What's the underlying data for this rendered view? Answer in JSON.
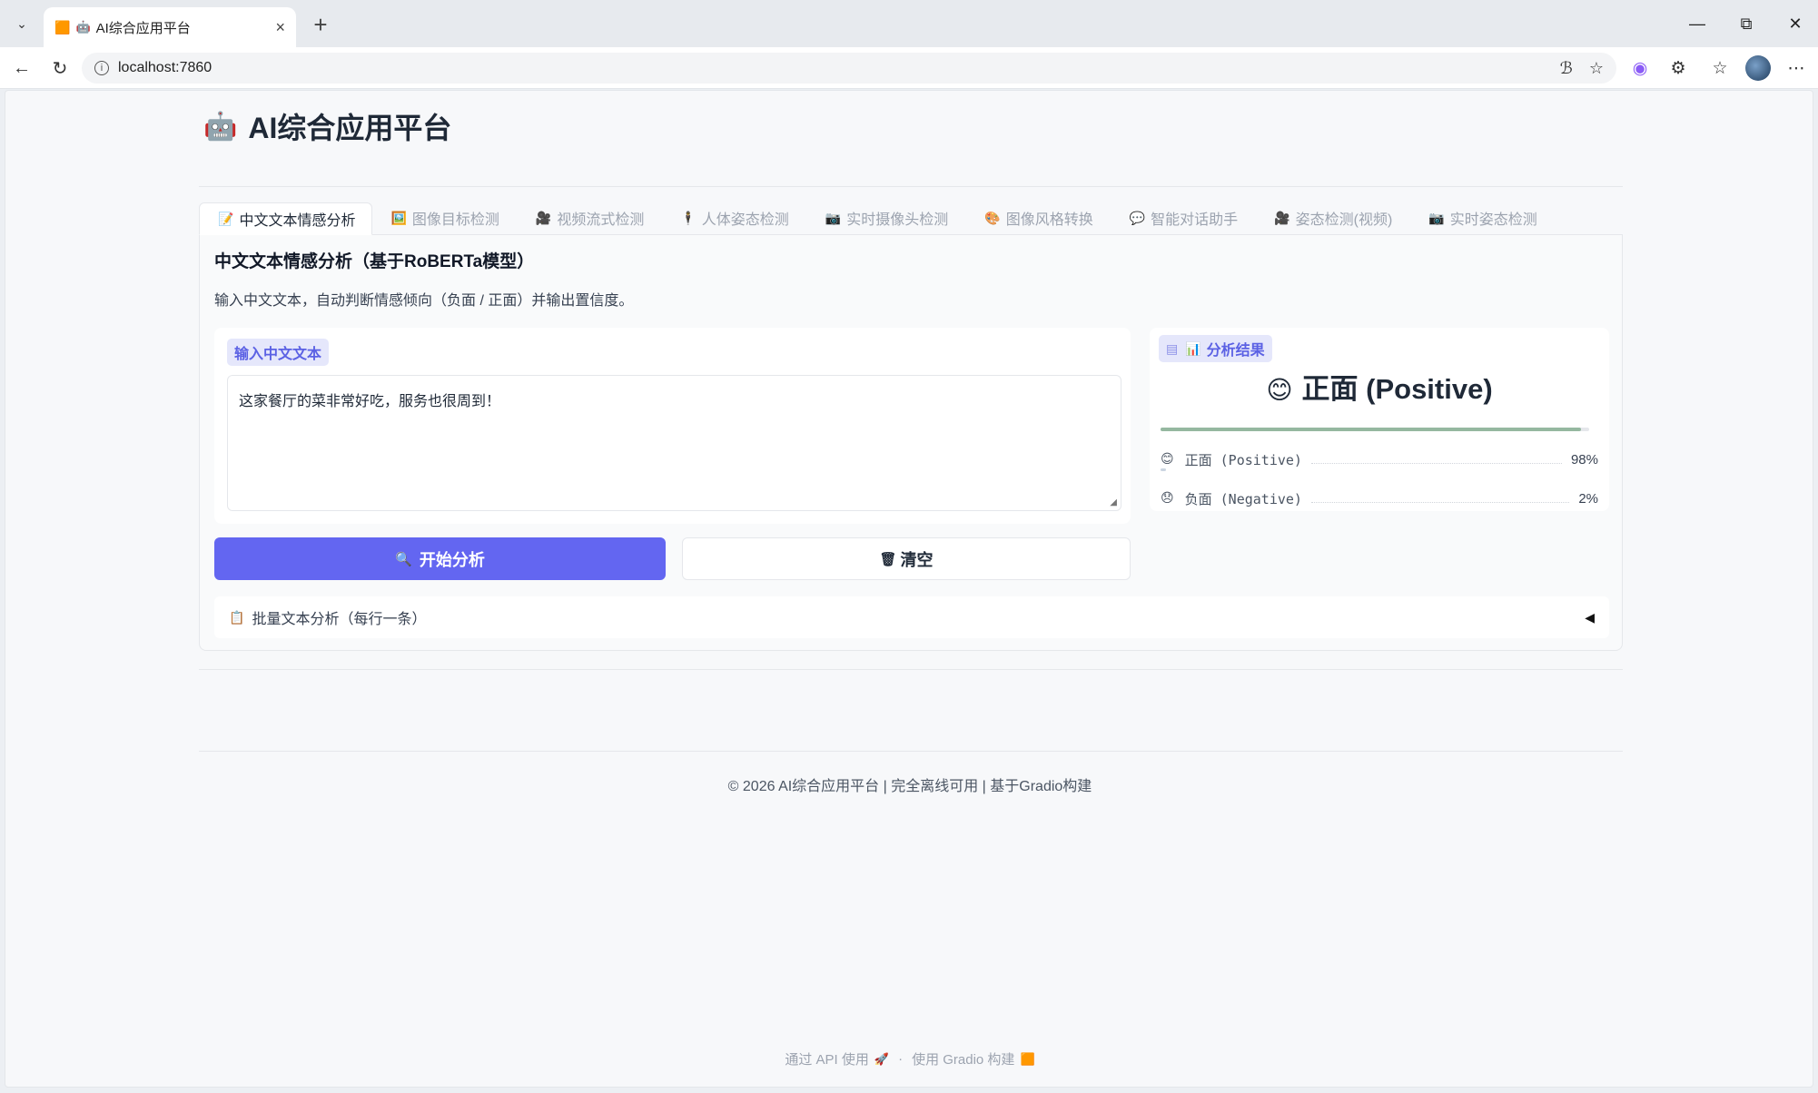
{
  "browser": {
    "tab_title": "AI综合应用平台",
    "url": "localhost:7860"
  },
  "app": {
    "title": "AI综合应用平台"
  },
  "tabs": [
    {
      "icon": "📝",
      "label": "中文文本情感分析",
      "active": true
    },
    {
      "icon": "🖼️",
      "label": "图像目标检测",
      "active": false
    },
    {
      "icon": "🎥",
      "label": "视频流式检测",
      "active": false
    },
    {
      "icon": "🕴",
      "label": "人体姿态检测",
      "active": false
    },
    {
      "icon": "📷",
      "label": "实时摄像头检测",
      "active": false
    },
    {
      "icon": "🎨",
      "label": "图像风格转换",
      "active": false
    },
    {
      "icon": "💬",
      "label": "智能对话助手",
      "active": false
    },
    {
      "icon": "🎥",
      "label": "姿态检测(视频)",
      "active": false
    },
    {
      "icon": "📷",
      "label": "实时姿态检测",
      "active": false
    }
  ],
  "sentiment": {
    "section_title": "中文文本情感分析（基于RoBERTa模型）",
    "description": "输入中文文本，自动判断情感倾向（负面 / 正面）并输出置信度。",
    "input_label": "输入中文文本",
    "input_value": "这家餐厅的菜非常好吃，服务也很周到！",
    "result_label": "分析结果",
    "result_main": "正面 (Positive)",
    "top_confidence": 0.98,
    "confidences": [
      {
        "label": "正面 (Positive)",
        "value": "98%"
      },
      {
        "label": "负面 (Negative)",
        "value": "2%"
      }
    ],
    "analyze_button": "开始分析",
    "clear_button": "清空",
    "batch_accordion": "批量文本分析（每行一条）"
  },
  "footer": {
    "text": "© 2026 AI综合应用平台 | 完全离线可用 | 基于Gradio构建",
    "api_link": "通过 API 使用",
    "separator": "·",
    "built_with": "使用 Gradio 构建"
  },
  "colors": {
    "primary": "#6366f1",
    "label_bg": "#e5e7fb",
    "confidence_bar": "#95b8a0"
  }
}
